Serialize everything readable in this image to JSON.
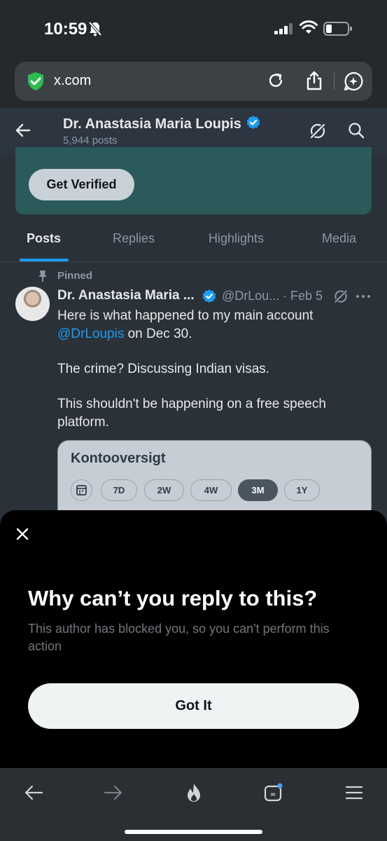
{
  "status_bar": {
    "time": "10:59"
  },
  "browser": {
    "url": "x.com"
  },
  "profile": {
    "name": "Dr. Anastasia Maria Loupis",
    "post_count": "5,944 posts",
    "get_verified_label": "Get Verified"
  },
  "tabs": [
    {
      "label": "Posts"
    },
    {
      "label": "Replies"
    },
    {
      "label": "Highlights"
    },
    {
      "label": "Media"
    }
  ],
  "tweet": {
    "pinned_label": "Pinned",
    "author": "Dr. Anastasia Maria ...",
    "handle": "@DrLou...",
    "date": "· Feb 5",
    "line1": "Here is what happened to my main account",
    "mention": "@DrLoupis",
    "line2_rest": " on Dec 30.",
    "paragraph2": "The crime? Discussing Indian visas.",
    "paragraph3": "This shouldn't be happening on a free speech platform.",
    "embed": {
      "title": "Kontooversigt",
      "ranges": [
        "7D",
        "2W",
        "4W",
        "3M",
        "1Y"
      ],
      "selected": "3M"
    }
  },
  "sheet": {
    "title": "Why can’t you reply to this?",
    "description": "This author has blocked you, so you can't perform this action",
    "button_label": "Got It"
  },
  "colors": {
    "accent": "#1d9bf0",
    "page_bg": "#2a3138",
    "sheet_bg": "#000000",
    "verified_card": "#2a5a5a"
  }
}
